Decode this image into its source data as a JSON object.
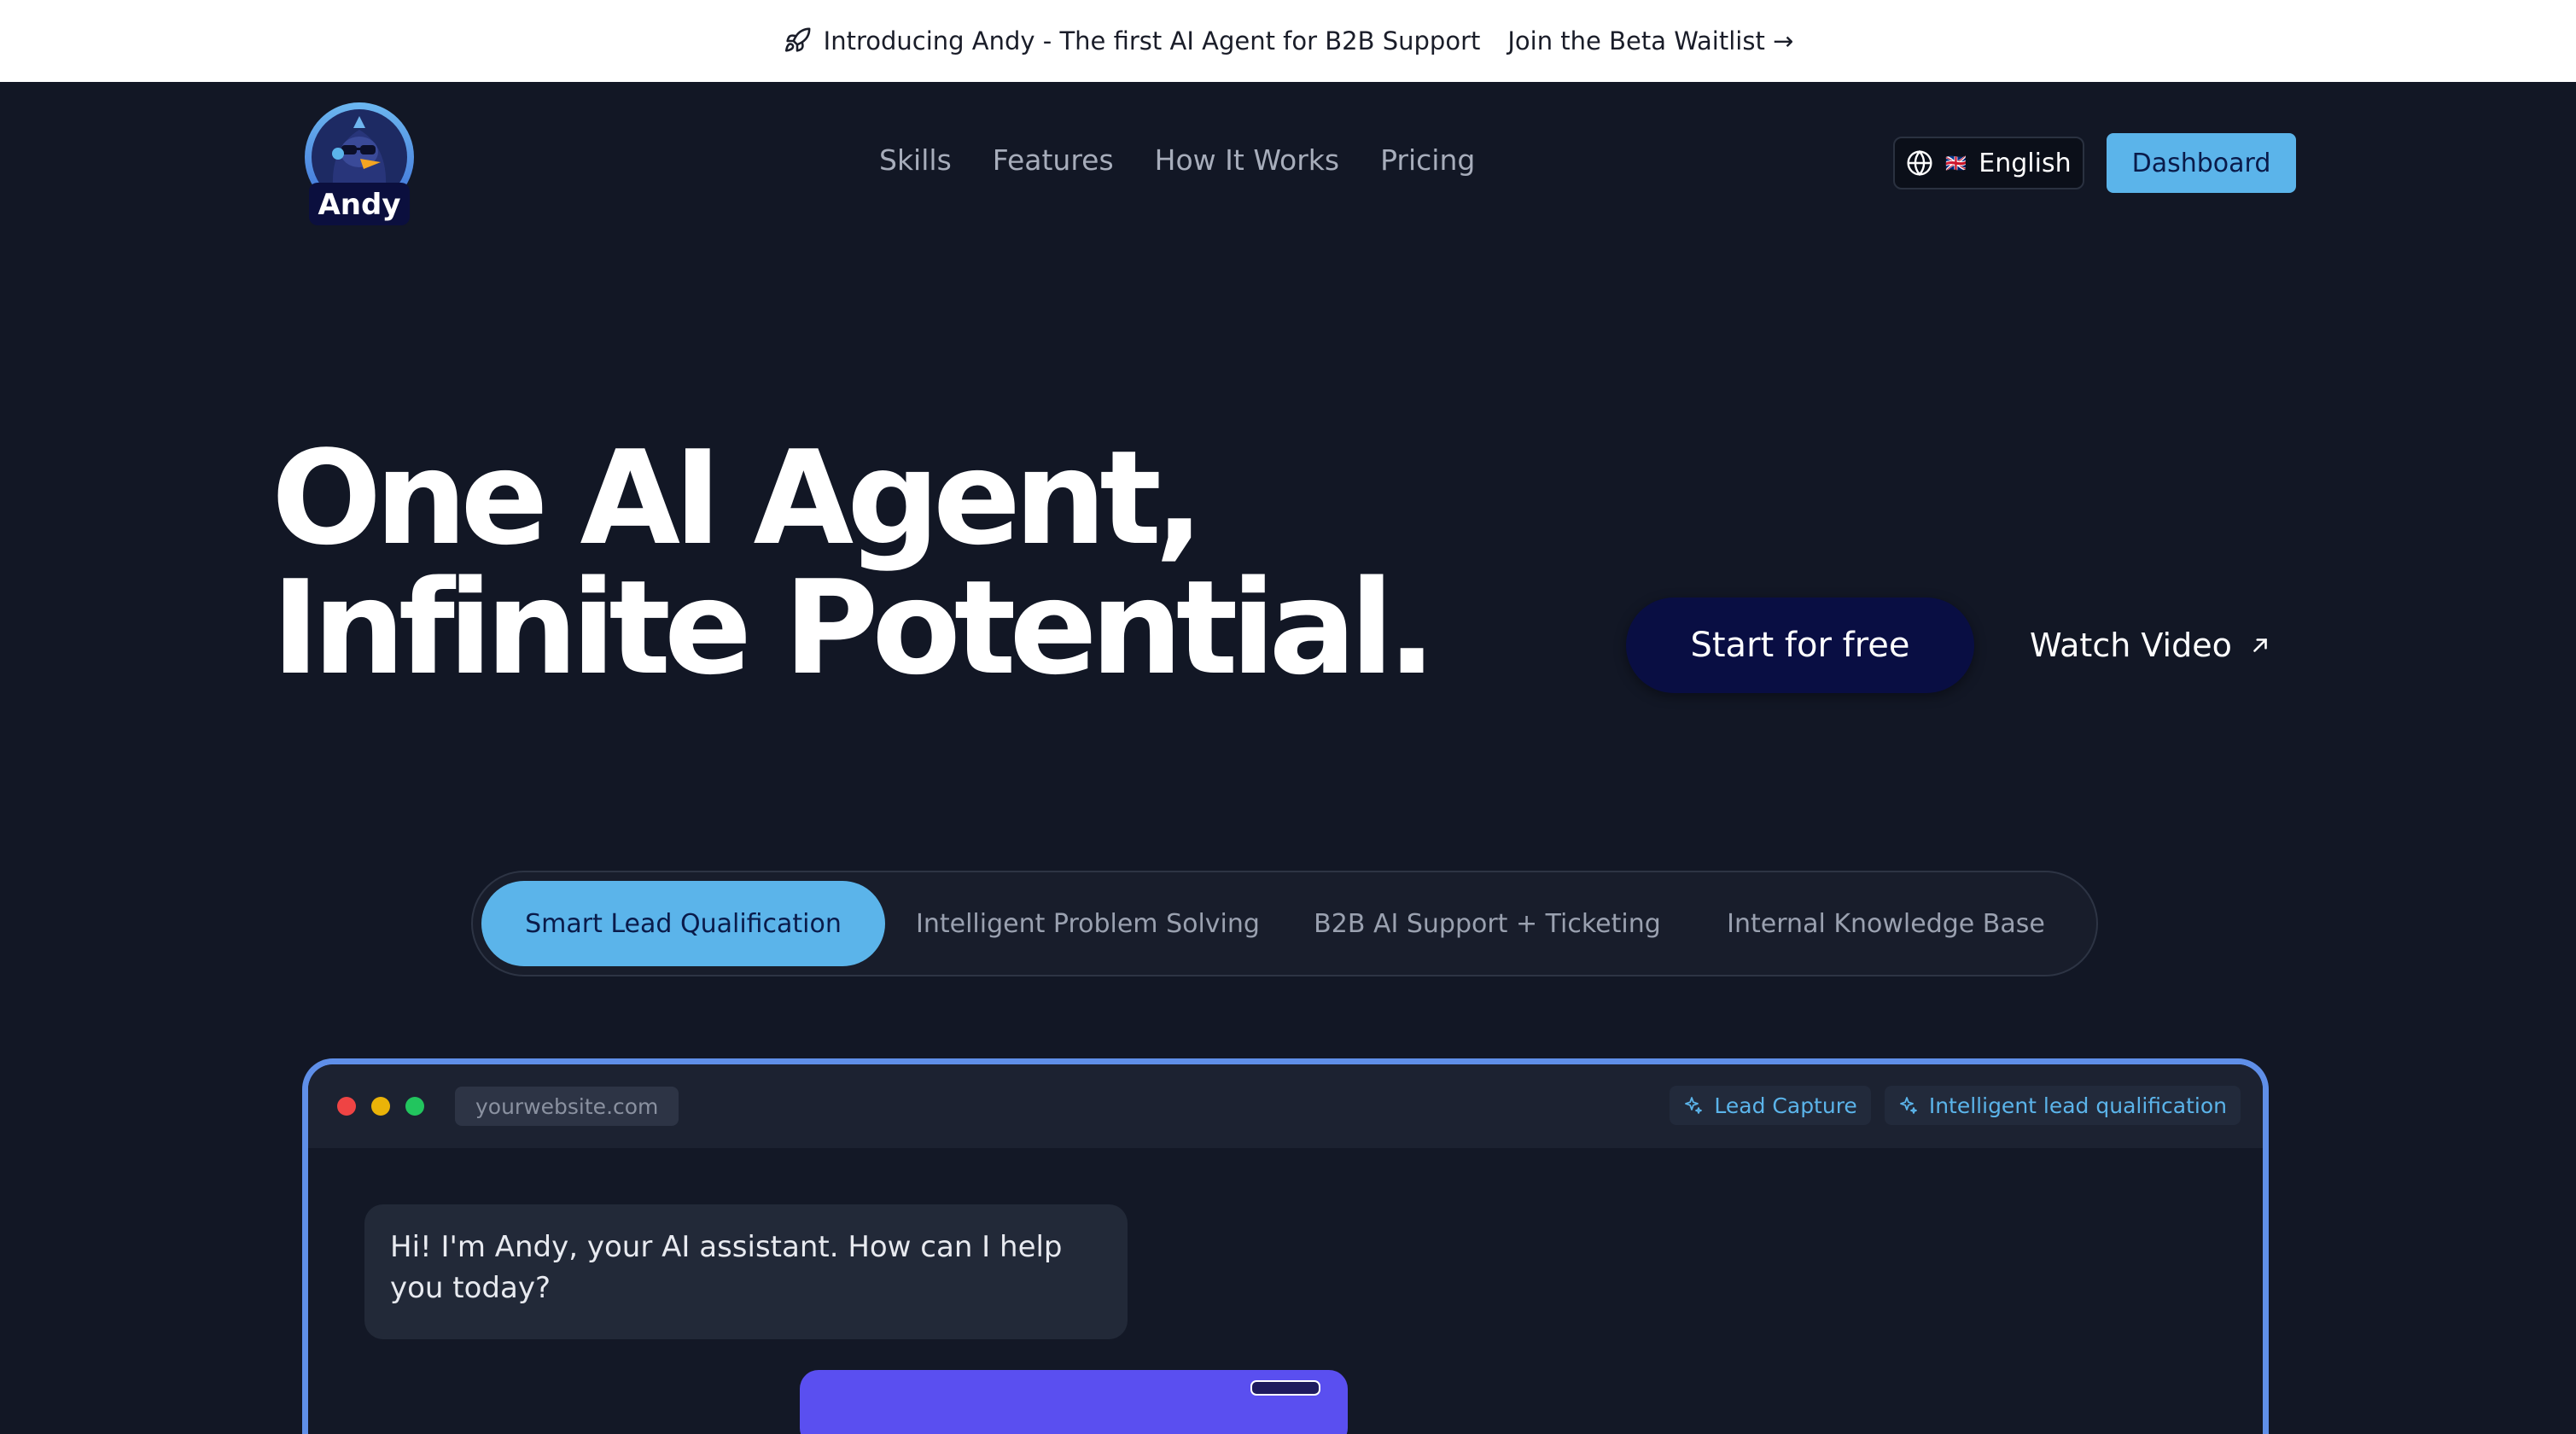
{
  "announcement": {
    "icon": "rocket-icon",
    "message": "Introducing Andy - The first AI Agent for B2B Support",
    "cta": "Join the Beta Waitlist →"
  },
  "logo": {
    "text": "Andy"
  },
  "nav": {
    "links": [
      "Skills",
      "Features",
      "How It Works",
      "Pricing"
    ],
    "language": {
      "icon": "globe-icon",
      "flag": "🇬🇧",
      "label": "English"
    },
    "dashboard_label": "Dashboard"
  },
  "hero": {
    "title_line1": "One AI Agent,",
    "title_line2": "Infinite Potential.",
    "primary_cta": "Start for free",
    "secondary_cta": "Watch Video"
  },
  "tabs": {
    "items": [
      {
        "label": "Smart Lead Qualification",
        "active": true
      },
      {
        "label": "Intelligent Problem Solving",
        "active": false
      },
      {
        "label": "B2B AI Support + Ticketing",
        "active": false
      },
      {
        "label": "Internal Knowledge Base",
        "active": false
      }
    ]
  },
  "demo": {
    "url": "yourwebsite.com",
    "badges": [
      "Lead Capture",
      "Intelligent lead qualification"
    ],
    "assistant_message": "Hi! I'm Andy, your AI assistant. How can I help you today?"
  },
  "colors": {
    "background": "#121725",
    "accent": "#5bb4ea",
    "primary_button": "#090e43",
    "window_border": "#5f8fe8",
    "user_bubble": "#5a4ff0"
  }
}
